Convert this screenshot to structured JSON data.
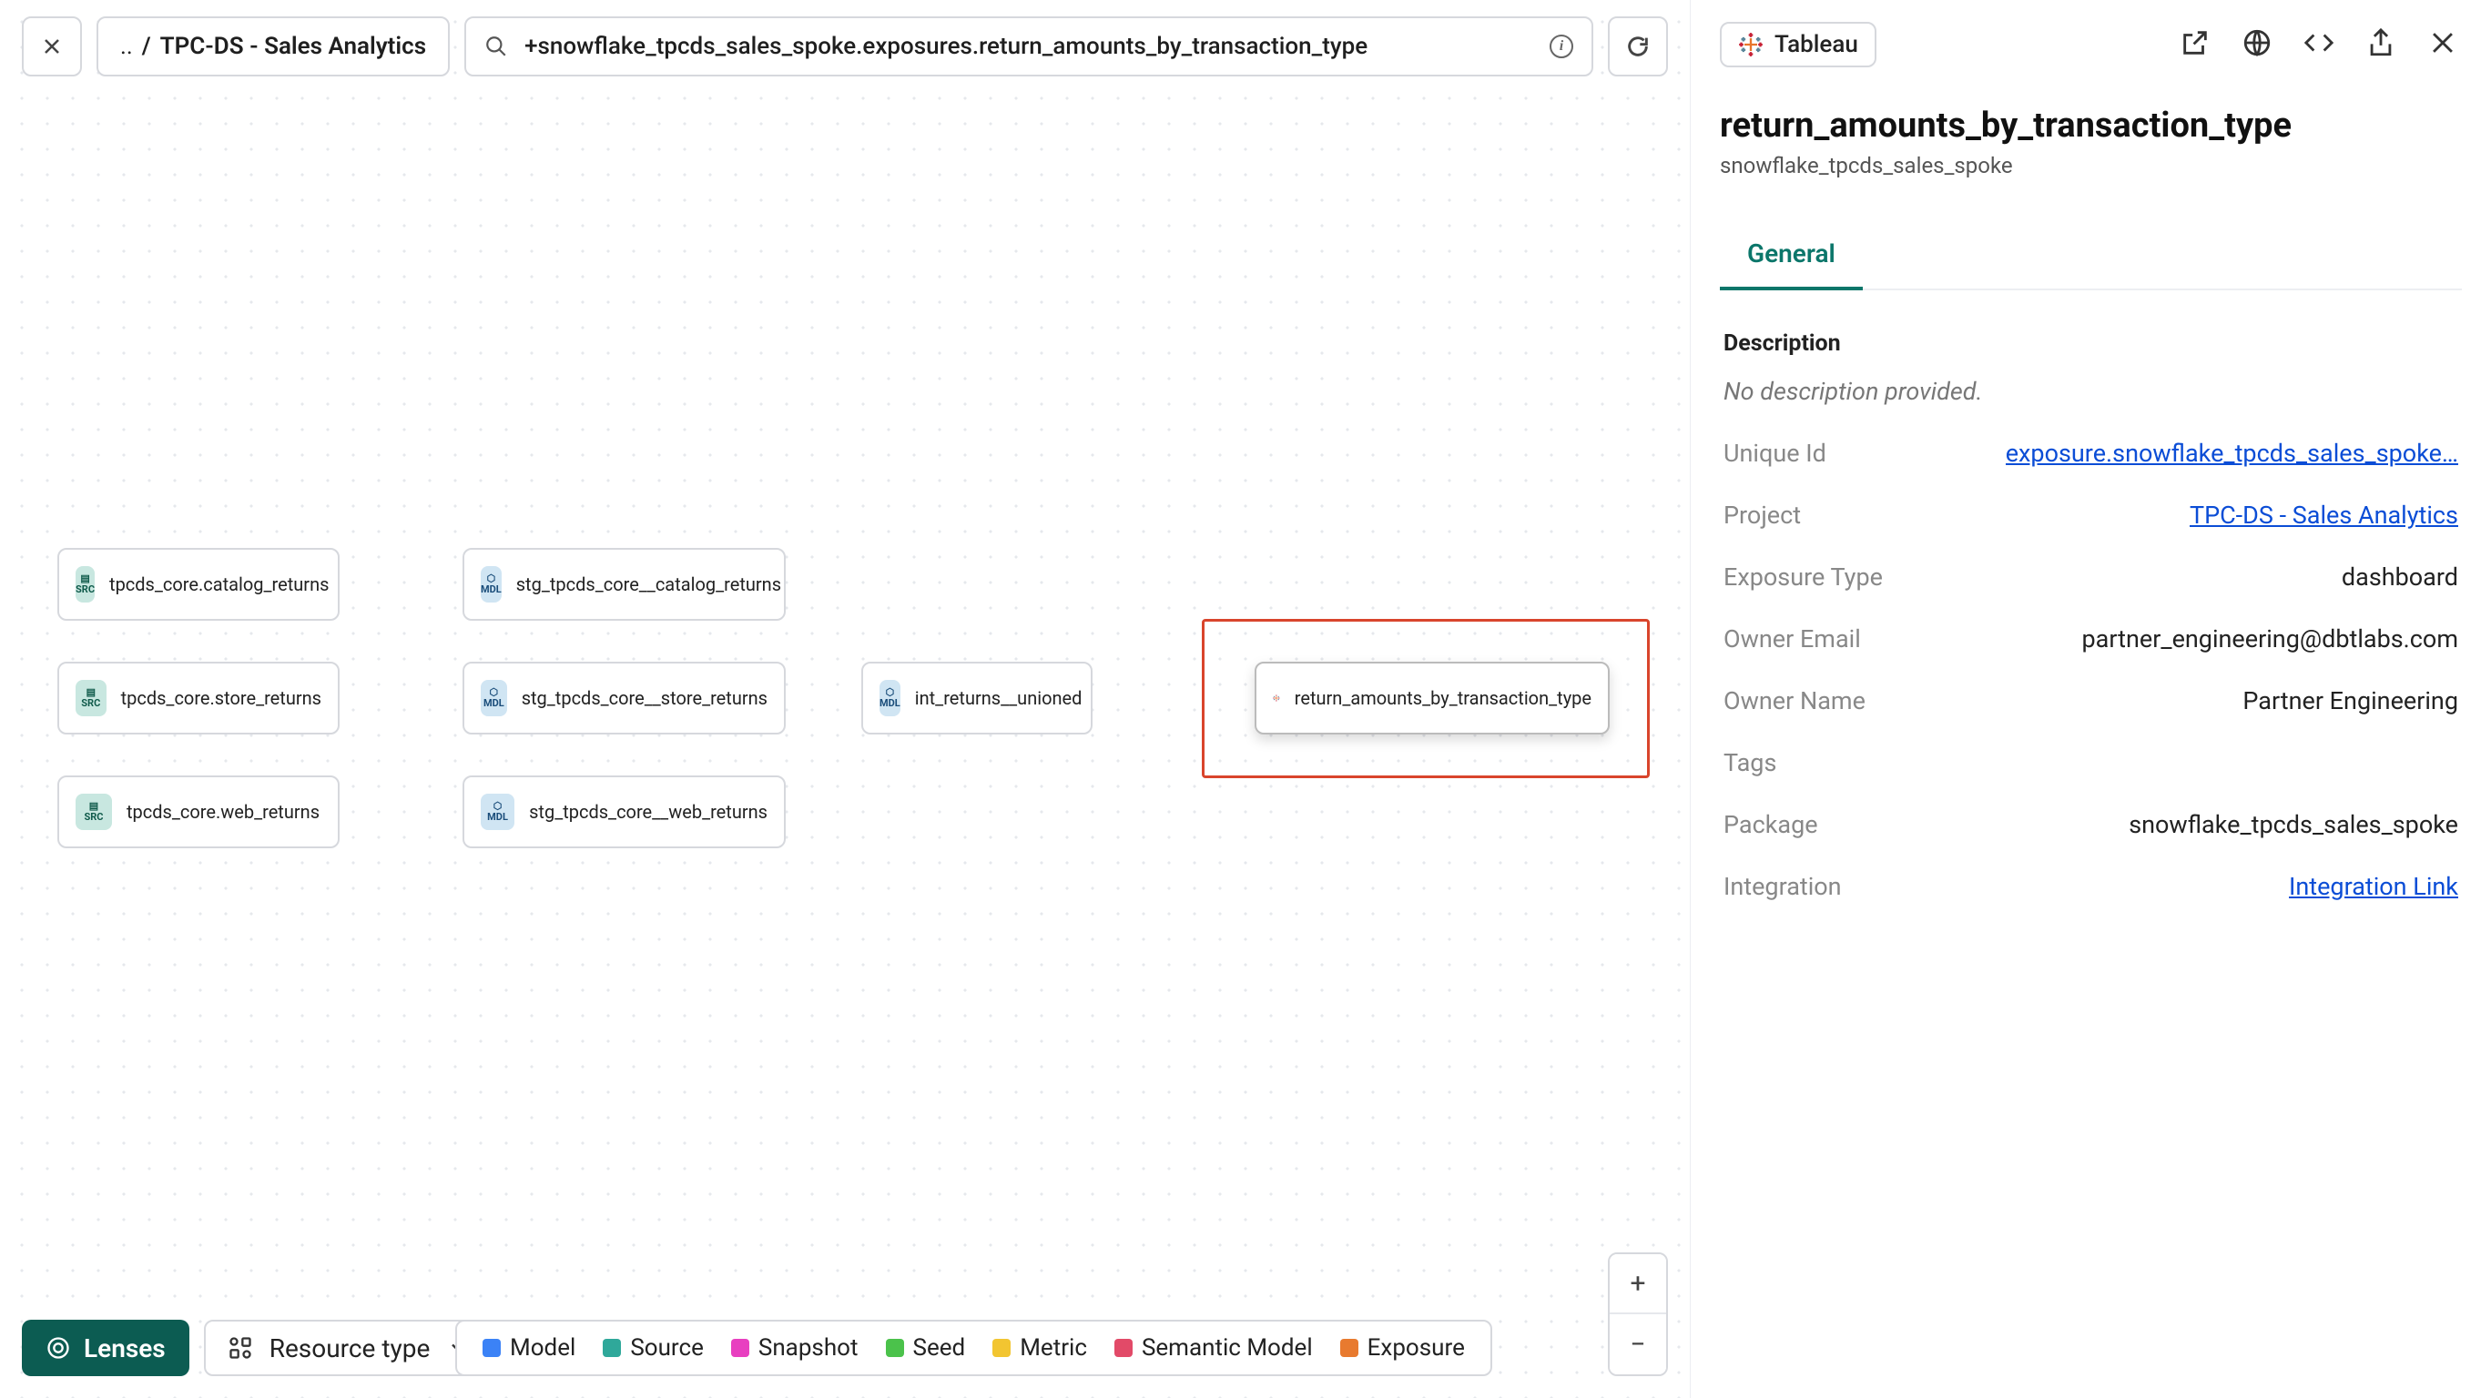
{
  "breadcrumb": {
    "prefix": "..",
    "sep": "/",
    "current": "TPC-DS - Sales Analytics"
  },
  "search": {
    "value": "+snowflake_tpcds_sales_spoke.exposures.return_amounts_by_transaction_type"
  },
  "nodes": {
    "src1": {
      "label": "tpcds_core.catalog_returns",
      "badge": "SRC"
    },
    "src2": {
      "label": "tpcds_core.store_returns",
      "badge": "SRC"
    },
    "src3": {
      "label": "tpcds_core.web_returns",
      "badge": "SRC"
    },
    "mdl1": {
      "label": "stg_tpcds_core__catalog_returns",
      "badge": "MDL"
    },
    "mdl2": {
      "label": "stg_tpcds_core__store_returns",
      "badge": "MDL"
    },
    "mdl3": {
      "label": "stg_tpcds_core__web_returns",
      "badge": "MDL"
    },
    "mdl4": {
      "label": "int_returns__unioned",
      "badge": "MDL"
    },
    "exp1": {
      "label": "return_amounts_by_transaction_type"
    }
  },
  "bottom": {
    "lenses": "Lenses",
    "resource_type": "Resource type",
    "legend": [
      {
        "label": "Model",
        "color": "#3b82f6"
      },
      {
        "label": "Source",
        "color": "#2fa89a"
      },
      {
        "label": "Snapshot",
        "color": "#e83fc0"
      },
      {
        "label": "Seed",
        "color": "#4bc24b"
      },
      {
        "label": "Metric",
        "color": "#f2c531"
      },
      {
        "label": "Semantic Model",
        "color": "#e24a68"
      },
      {
        "label": "Exposure",
        "color": "#e87a2f"
      }
    ]
  },
  "panel": {
    "chip": "Tableau",
    "title": "return_amounts_by_transaction_type",
    "subtitle": "snowflake_tpcds_sales_spoke",
    "tab": "General",
    "section_description": "Description",
    "description_empty": "No description provided.",
    "fields": {
      "unique_id": {
        "k": "Unique Id",
        "v": "exposure.snowflake_tpcds_sales_spoke…",
        "link": true
      },
      "project": {
        "k": "Project",
        "v": "TPC-DS - Sales Analytics",
        "link": true
      },
      "exposure_type": {
        "k": "Exposure Type",
        "v": "dashboard"
      },
      "owner_email": {
        "k": "Owner Email",
        "v": "partner_engineering@dbtlabs.com"
      },
      "owner_name": {
        "k": "Owner Name",
        "v": "Partner Engineering"
      },
      "tags": {
        "k": "Tags",
        "v": ""
      },
      "package": {
        "k": "Package",
        "v": "snowflake_tpcds_sales_spoke"
      },
      "integration": {
        "k": "Integration",
        "v": "Integration Link",
        "link": true
      }
    }
  }
}
